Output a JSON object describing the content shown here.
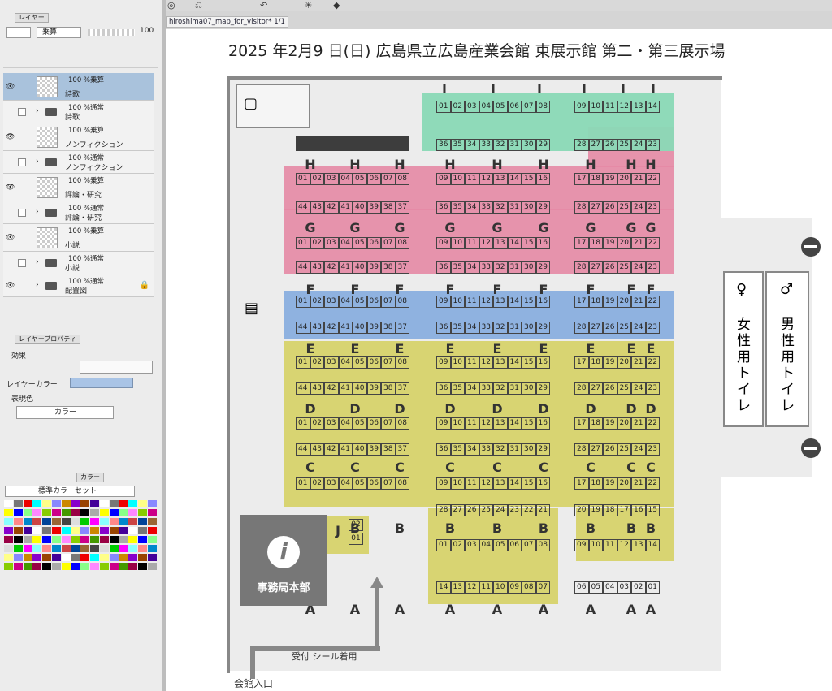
{
  "toolbar": {
    "icons": [
      "undo-icon",
      "redo-icon",
      "selection-icon",
      "transform-icon",
      "fill-icon"
    ]
  },
  "layer_panel": {
    "tab_label": "レイヤー",
    "blend_mode": "乗算",
    "opacity": "100",
    "layers": [
      {
        "mode": "100 %乗算",
        "name": "詩歌",
        "type": "raster",
        "visible": true,
        "selected": true
      },
      {
        "mode": "100 %通常",
        "name": "詩歌",
        "type": "folder",
        "visible": false,
        "selected": false
      },
      {
        "mode": "100 %乗算",
        "name": "ノンフィクション",
        "type": "raster",
        "visible": true,
        "selected": false
      },
      {
        "mode": "100 %通常",
        "name": "ノンフィクション",
        "type": "folder",
        "visible": false,
        "selected": false
      },
      {
        "mode": "100 %乗算",
        "name": "評論・研究",
        "type": "raster",
        "visible": true,
        "selected": false
      },
      {
        "mode": "100 %通常",
        "name": "評論・研究",
        "type": "folder",
        "visible": false,
        "selected": false
      },
      {
        "mode": "100 %乗算",
        "name": "小説",
        "type": "raster",
        "visible": true,
        "selected": false
      },
      {
        "mode": "100 %通常",
        "name": "小説",
        "type": "folder",
        "visible": false,
        "selected": false
      },
      {
        "mode": "100 %通常",
        "name": "配置図",
        "type": "folder",
        "visible": true,
        "selected": false,
        "locked": true
      }
    ]
  },
  "property_panel": {
    "tab_label": "レイヤープロパティ",
    "effect_label": "効果",
    "layer_color_label": "レイヤーカラー",
    "expression_label": "表現色",
    "expression_value": "カラー"
  },
  "color_set_panel": {
    "tab_label": "カラー",
    "set_name": "標準カラーセット"
  },
  "document_tab": {
    "title": "hiroshima07_map_for_visitor* 1/1"
  },
  "map": {
    "title": "2025 年2月9 日(日) 広島県立広島産業会館 東展示館 第二・第三展示場",
    "office_label": "事務局本部",
    "info_glyph": "i",
    "reception_label": "受付 シール着用",
    "entrance_label": "会館入口",
    "female_toilet": "女性用トイレ",
    "male_toilet": "男性用トイレ",
    "colors": {
      "poetry": "#8ad9b6",
      "nonfiction": "#e68aa5",
      "critique": "#8fb2e0",
      "novel": "#d8d472"
    }
  }
}
